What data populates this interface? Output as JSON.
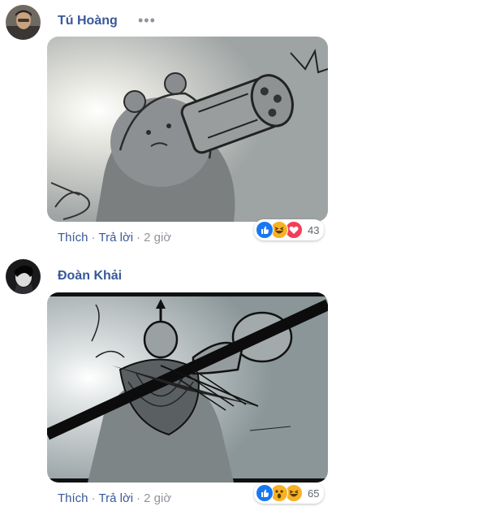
{
  "comments": [
    {
      "author": "Tú Hoàng",
      "more": "•••",
      "actions": {
        "like": "Thích",
        "sep": "·",
        "reply": "Trả lời",
        "sep2": "·",
        "time": "2 giờ"
      },
      "reactions": {
        "types": [
          "like-icon",
          "haha-icon",
          "love-icon"
        ],
        "count": "43"
      }
    },
    {
      "author": "Đoàn Khải",
      "actions": {
        "like": "Thích",
        "sep": "·",
        "reply": "Trả lời",
        "sep2": "·",
        "time": "2 giờ"
      },
      "reactions": {
        "types": [
          "like-icon",
          "wow-icon",
          "haha-icon"
        ],
        "count": "65"
      }
    }
  ],
  "colors": {
    "link": "#385898",
    "meta": "#90949c",
    "like": "#1877f2",
    "love": "#f33e58",
    "haha": "#f7b125"
  }
}
